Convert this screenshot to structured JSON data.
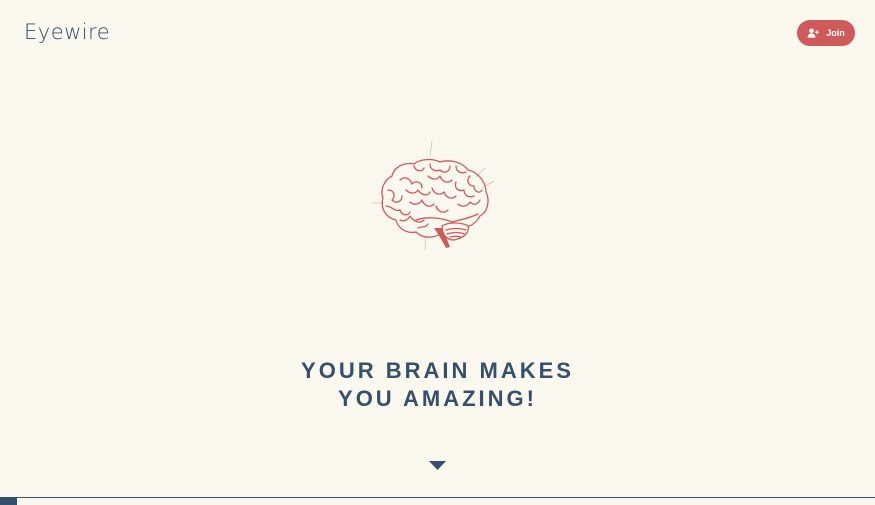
{
  "header": {
    "logo_text": "Eyewire",
    "join_label": "Join"
  },
  "hero": {
    "headline_line1": "YOUR BRAIN MAKES",
    "headline_line2": "YOU AMAZING!",
    "illustration_icon": "brain-icon",
    "scroll_icon": "down-arrow-icon"
  },
  "colors": {
    "background": "#fbf8f0",
    "brand_navy": "#34506b",
    "accent_red": "#cf5a5a"
  }
}
